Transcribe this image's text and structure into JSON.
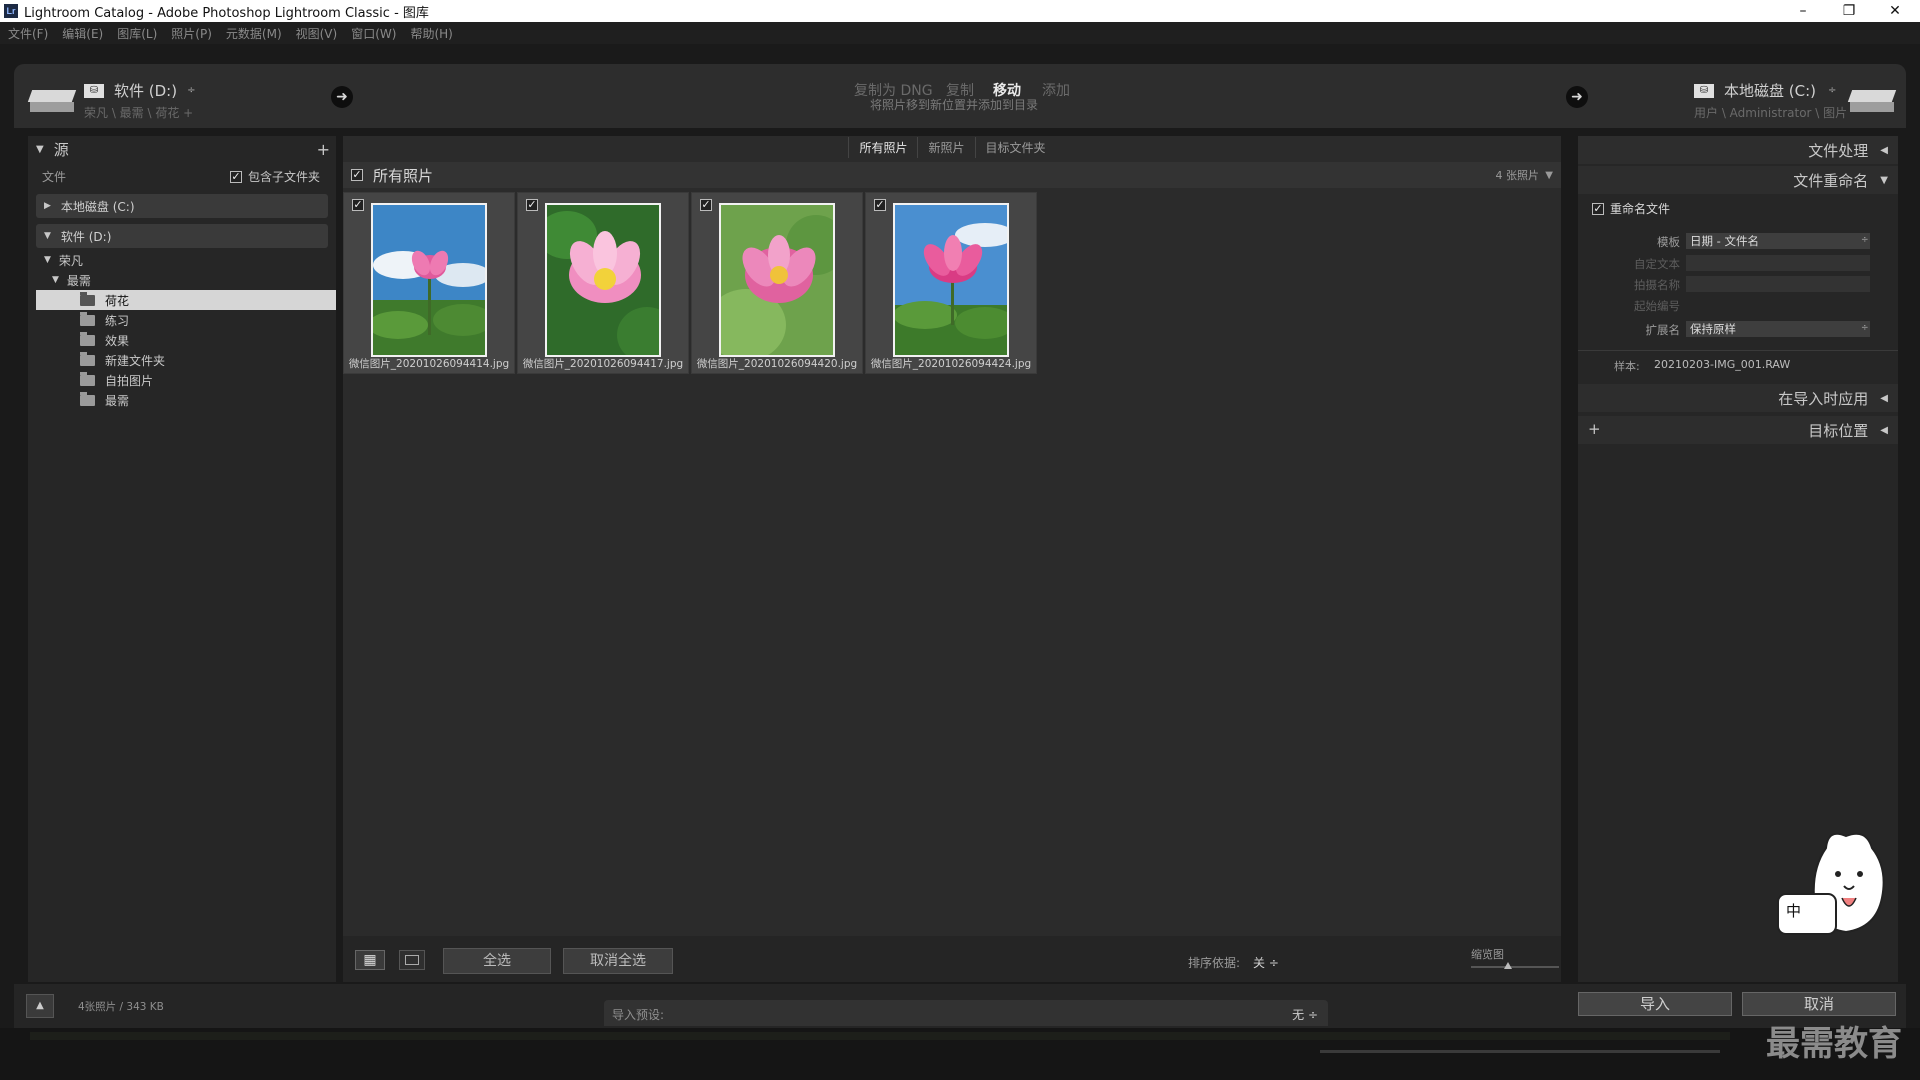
{
  "window": {
    "title": "Lightroom Catalog - Adobe Photoshop Lightroom Classic - 图库",
    "app_icon": "Lr",
    "controls": [
      "–",
      "❐",
      "✕"
    ]
  },
  "menu": [
    "文件(F)",
    "编辑(E)",
    "图库(L)",
    "照片(P)",
    "元数据(M)",
    "视图(V)",
    "窗口(W)",
    "帮助(H)"
  ],
  "header": {
    "source_drive": "软件 (D:)",
    "source_path": "荣凡 \\ 最需 \\ 荷花 +",
    "modes": [
      "复制为 DNG",
      "复制",
      "移动",
      "添加"
    ],
    "active_mode": "移动",
    "mode_desc": "将照片移到新位置并添加到目录",
    "dest_drive": "本地磁盘 (C:)",
    "dest_path": "用户 \\ Administrator \\ 图片"
  },
  "left_panel": {
    "title": "源",
    "files_label": "文件",
    "include_subfolders": "包含子文件夹",
    "volumes": [
      "本地磁盘 (C:)",
      "软件 (D:)"
    ],
    "tree_level1": "荣凡",
    "tree_level2": "最需",
    "folders": [
      "荷花",
      "练习",
      "效果",
      "新建文件夹",
      "自拍图片",
      "最需"
    ]
  },
  "center": {
    "tabs": [
      "所有照片",
      "新照片",
      "目标文件夹"
    ],
    "grid_title": "所有照片",
    "count": "4 张照片",
    "photos": [
      {
        "filename": "微信图片_20201026094414.jpg"
      },
      {
        "filename": "微信图片_20201026094417.jpg"
      },
      {
        "filename": "微信图片_20201026094420.jpg"
      },
      {
        "filename": "微信图片_20201026094424.jpg"
      }
    ],
    "select_all": "全选",
    "deselect_all": "取消全选",
    "sort_label": "排序依据:",
    "sort_value": "关 ÷",
    "thumb_label": "缩览图"
  },
  "right_panel": {
    "file_handling": "文件处理",
    "file_rename": "文件重命名",
    "rename_files": "重命名文件",
    "template_label": "模板",
    "template_value": "日期 - 文件名",
    "custom_text": "自定文本",
    "shoot_name": "拍摄名称",
    "start_number": "起始编号",
    "extension_label": "扩展名",
    "extension_value": "保持原样",
    "sample_label": "样本:",
    "sample_value": "20210203-IMG_001.RAW",
    "apply_during_import": "在导入时应用",
    "destination": "目标位置"
  },
  "footer": {
    "status": "4张照片 / 343 KB",
    "preset_label": "导入预设:",
    "preset_value": "无 ÷",
    "import": "导入",
    "cancel": "取消"
  },
  "overlay": {
    "mascot_text": "中",
    "watermark": "最需教育"
  }
}
